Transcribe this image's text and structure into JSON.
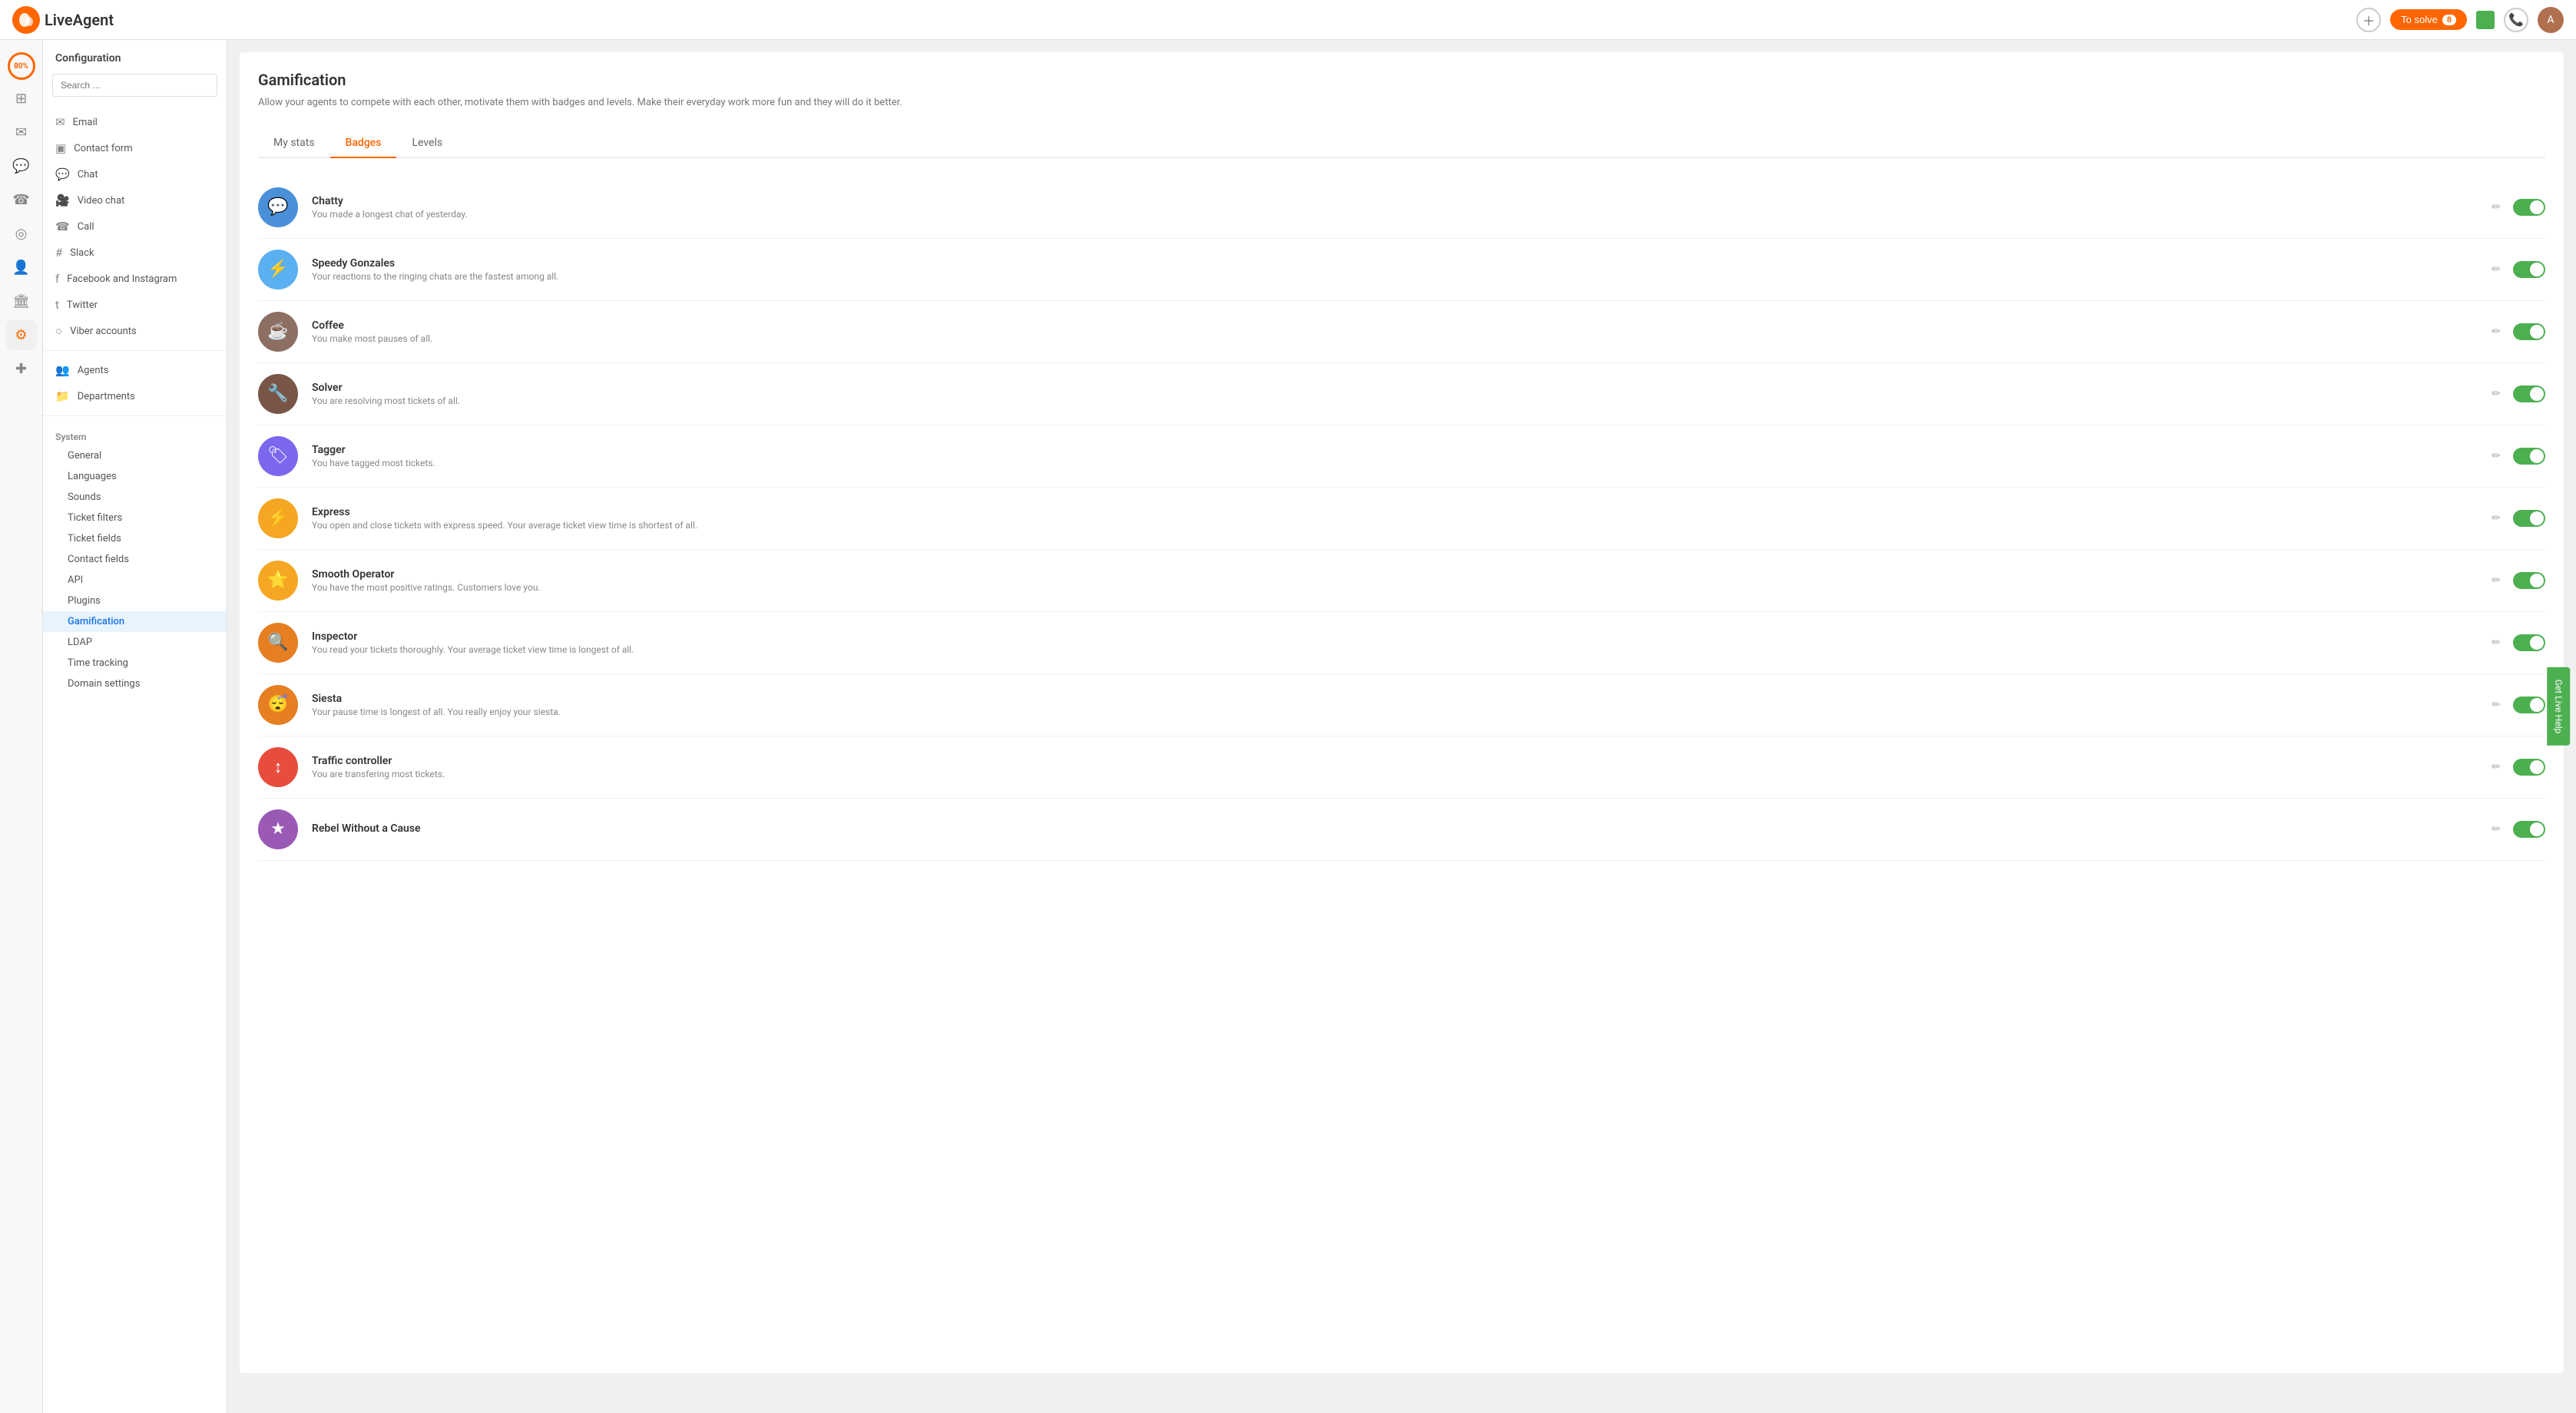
{
  "topnav": {
    "logo_text": "LiveAgent",
    "solve_label": "To solve",
    "solve_count": "8",
    "avatar_initials": "A"
  },
  "left_nav": {
    "progress": "80%",
    "items": [
      {
        "name": "dashboard",
        "icon": "⊞"
      },
      {
        "name": "tickets",
        "icon": "✉"
      },
      {
        "name": "chat",
        "icon": "💬"
      },
      {
        "name": "call",
        "icon": "☎"
      },
      {
        "name": "reports",
        "icon": "◯"
      },
      {
        "name": "contacts",
        "icon": "👤"
      },
      {
        "name": "building",
        "icon": "🏛"
      },
      {
        "name": "settings",
        "icon": "⚙"
      },
      {
        "name": "plugin",
        "icon": "✚"
      }
    ]
  },
  "sidebar": {
    "title": "Configuration",
    "search_placeholder": "Search ...",
    "nav_items": [
      {
        "name": "Email",
        "icon": "✉"
      },
      {
        "name": "Contact form",
        "icon": "▣"
      },
      {
        "name": "Chat",
        "icon": "💬"
      },
      {
        "name": "Video chat",
        "icon": "🎥"
      },
      {
        "name": "Call",
        "icon": "☎"
      },
      {
        "name": "Slack",
        "icon": "#"
      },
      {
        "name": "Facebook and Instagram",
        "icon": "f"
      },
      {
        "name": "Twitter",
        "icon": "t"
      },
      {
        "name": "Viber accounts",
        "icon": "○"
      }
    ],
    "agent_items": [
      {
        "name": "Agents",
        "icon": "👥"
      },
      {
        "name": "Departments",
        "icon": "📁"
      }
    ],
    "system_label": "System",
    "system_items": [
      {
        "name": "General"
      },
      {
        "name": "Languages"
      },
      {
        "name": "Sounds"
      },
      {
        "name": "Ticket filters"
      },
      {
        "name": "Ticket fields"
      },
      {
        "name": "Contact fields"
      },
      {
        "name": "API"
      },
      {
        "name": "Plugins"
      },
      {
        "name": "Gamification",
        "active": true
      },
      {
        "name": "LDAP"
      },
      {
        "name": "Time tracking"
      },
      {
        "name": "Domain settings"
      }
    ]
  },
  "main": {
    "title": "Gamification",
    "subtitle": "Allow your agents to compete with each other, motivate them with badges and levels. Make their everyday work more fun and they will do it better.",
    "tabs": [
      {
        "label": "My stats"
      },
      {
        "label": "Badges",
        "active": true
      },
      {
        "label": "Levels"
      }
    ],
    "badges": [
      {
        "name": "Chatty",
        "desc": "You made a longest chat of yesterday.",
        "color": "#4a90d9",
        "icon": "💬",
        "enabled": true
      },
      {
        "name": "Speedy Gonzales",
        "desc": "Your reactions to the ringing chats are the fastest among all.",
        "color": "#5ab0f0",
        "icon": "⚡",
        "enabled": true
      },
      {
        "name": "Coffee",
        "desc": "You make most pauses of all.",
        "color": "#8d6e63",
        "icon": "☕",
        "enabled": true
      },
      {
        "name": "Solver",
        "desc": "You are resolving most tickets of all.",
        "color": "#795548",
        "icon": "🔧",
        "enabled": true
      },
      {
        "name": "Tagger",
        "desc": "You have tagged most tickets.",
        "color": "#7b68ee",
        "icon": "🏷",
        "enabled": true
      },
      {
        "name": "Express",
        "desc": "You open and close tickets with express speed. Your average ticket view time is shortest of all.",
        "color": "#f5a623",
        "icon": "⚡",
        "enabled": true
      },
      {
        "name": "Smooth Operator",
        "desc": "You have the most positive ratings. Customers love you.",
        "color": "#f5a623",
        "icon": "⭐",
        "enabled": true
      },
      {
        "name": "Inspector",
        "desc": "You read your tickets thoroughly. Your average ticket view time is longest of all.",
        "color": "#e67e22",
        "icon": "🔍",
        "enabled": true
      },
      {
        "name": "Siesta",
        "desc": "Your pause time is longest of all. You really enjoy your siesta.",
        "color": "#e67e22",
        "icon": "😴",
        "enabled": true
      },
      {
        "name": "Traffic controller",
        "desc": "You are transfering most tickets.",
        "color": "#e74c3c",
        "icon": "↕",
        "enabled": true
      },
      {
        "name": "Rebel Without a Cause",
        "desc": "",
        "color": "#9b59b6",
        "icon": "★",
        "enabled": true
      }
    ]
  },
  "live_help": "Get Live Help"
}
